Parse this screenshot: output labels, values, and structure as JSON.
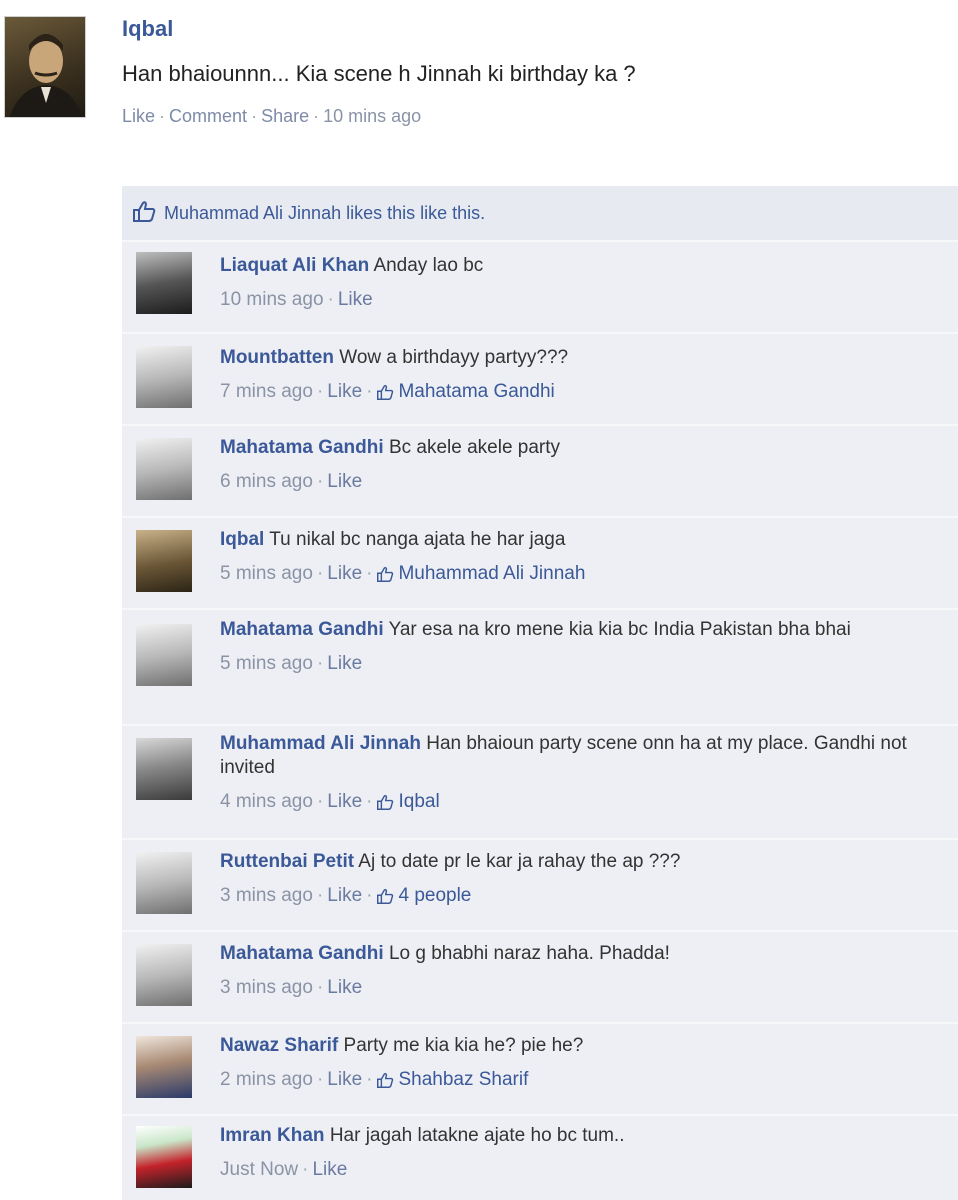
{
  "post": {
    "author": "Iqbal",
    "text": "Han bhaiounnn... Kia scene h Jinnah ki birthday ka ?",
    "actions": {
      "like": "Like",
      "comment": "Comment",
      "share": "Share",
      "time": "10 mins ago"
    }
  },
  "likes": {
    "text": "Muhammad Ali Jinnah likes this like this.",
    "icon": "thumbs-up-icon"
  },
  "comments": [
    {
      "name": "Liaquat Ali Khan",
      "text": "Anday lao bc",
      "time": "10 mins ago",
      "like_label": "Like",
      "liker": ""
    },
    {
      "name": "Mountbatten",
      "text": "Wow a birthdayy partyy???",
      "time": "7 mins ago",
      "like_label": "Like",
      "liker": "Mahatama Gandhi"
    },
    {
      "name": "Mahatama Gandhi",
      "text": "Bc akele akele party",
      "time": "6 mins ago",
      "like_label": "Like",
      "liker": ""
    },
    {
      "name": "Iqbal",
      "text": "Tu nikal bc nanga ajata he har jaga",
      "time": "5 mins ago",
      "like_label": "Like",
      "liker": "Muhammad Ali Jinnah"
    },
    {
      "name": "Mahatama Gandhi",
      "text": "Yar esa na kro mene kia kia bc India Pakistan bha bhai",
      "time": "5 mins ago",
      "like_label": "Like",
      "liker": ""
    },
    {
      "name": "Muhammad Ali Jinnah",
      "text": "Han bhaioun party scene onn ha at my place. Gandhi not invited",
      "time": "4 mins ago",
      "like_label": "Like",
      "liker": "Iqbal"
    },
    {
      "name": "Ruttenbai Petit",
      "text": "Aj to date pr le kar ja rahay the ap ???",
      "time": "3 mins ago",
      "like_label": "Like",
      "liker": "4 people"
    },
    {
      "name": "Mahatama Gandhi",
      "text": "Lo g bhabhi naraz haha. Phadda!",
      "time": "3 mins ago",
      "like_label": "Like",
      "liker": ""
    },
    {
      "name": "Nawaz Sharif",
      "text": "Party me kia kia he? pie he?",
      "time": "2 mins ago",
      "like_label": "Like",
      "liker": "Shahbaz Sharif"
    },
    {
      "name": "Imran Khan",
      "text": "Har jagah latakne ajate ho bc tum..",
      "time": "Just Now",
      "like_label": "Like",
      "liker": ""
    }
  ],
  "colors": {
    "link": "#3b5998",
    "meta": "#8a93a6",
    "comments_bg": "#edeff4"
  }
}
